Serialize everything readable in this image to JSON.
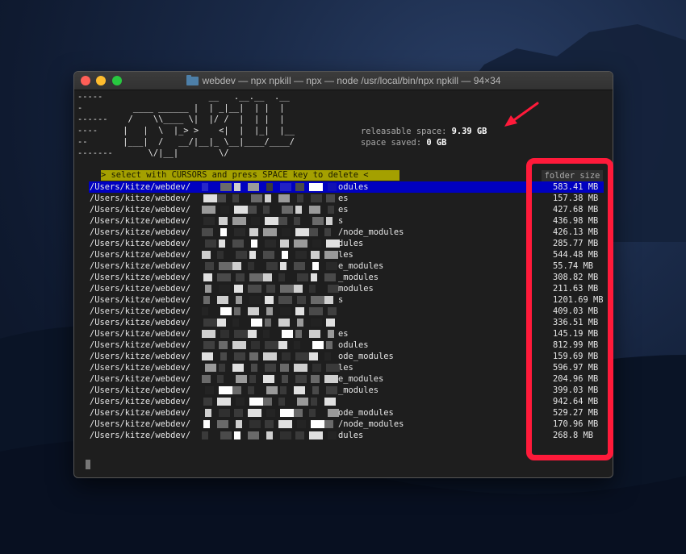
{
  "window": {
    "title": "webdev — npx npkill — npx — node /usr/local/bin/npx npkill — 94×34"
  },
  "banner": {
    "ascii_lines": [
      "-----                     __   .__.__  .__",
      "-          ____ ______ |  | _|__|  | |  |",
      "------    /    \\\\____ \\|  |/ /  |  | |  |",
      "----     |   |  \\  |_> >    <|  |  |_|  |__",
      "--       |___|  /   __/|__|_ \\__|____/____/",
      "-------       \\/|__|        \\/"
    ],
    "releasable_label": "releasable space:",
    "releasable_value": "9.39 GB",
    "saved_label": "space saved:",
    "saved_value": "0 GB"
  },
  "instructions": "> select with CURSORS and press SPACE key to delete <",
  "column_header": "folder size",
  "rows": [
    {
      "path": "/Users/kitze/webdev/",
      "tail": "odules",
      "size": "583.41 MB",
      "selected": true
    },
    {
      "path": "/Users/kitze/webdev/",
      "tail": "es",
      "size": "157.38 MB"
    },
    {
      "path": "/Users/kitze/webdev/",
      "tail": "es",
      "size": "427.68 MB"
    },
    {
      "path": "/Users/kitze/webdev/",
      "tail": "s",
      "size": "436.98 MB"
    },
    {
      "path": "/Users/kitze/webdev/",
      "tail": "/node_modules",
      "size": "426.13 MB"
    },
    {
      "path": "/Users/kitze/webdev/",
      "tail": "dules",
      "size": "285.77 MB"
    },
    {
      "path": "/Users/kitze/webdev/",
      "tail": "les",
      "size": "544.48 MB"
    },
    {
      "path": "/Users/kitze/webdev/",
      "tail": "e_modules",
      "size": "55.74 MB"
    },
    {
      "path": "/Users/kitze/webdev/",
      "tail": "_modules",
      "size": "308.82 MB"
    },
    {
      "path": "/Users/kitze/webdev/",
      "tail": "modules",
      "size": "211.63 MB"
    },
    {
      "path": "/Users/kitze/webdev/",
      "tail": "s",
      "size": "1201.69 MB"
    },
    {
      "path": "/Users/kitze/webdev/",
      "tail": "",
      "size": "409.03 MB"
    },
    {
      "path": "/Users/kitze/webdev/",
      "tail": "",
      "size": "336.51 MB"
    },
    {
      "path": "/Users/kitze/webdev/",
      "tail": "es",
      "size": "145.19 MB"
    },
    {
      "path": "/Users/kitze/webdev/",
      "tail": "odules",
      "size": "812.99 MB"
    },
    {
      "path": "/Users/kitze/webdev/",
      "tail": "ode_modules",
      "size": "159.69 MB"
    },
    {
      "path": "/Users/kitze/webdev/",
      "tail": "les",
      "size": "596.97 MB"
    },
    {
      "path": "/Users/kitze/webdev/",
      "tail": "e_modules",
      "size": "204.96 MB"
    },
    {
      "path": "/Users/kitze/webdev/",
      "tail": "_modules",
      "size": "399.03 MB"
    },
    {
      "path": "/Users/kitze/webdev/",
      "tail": "",
      "size": "942.64 MB"
    },
    {
      "path": "/Users/kitze/webdev/",
      "tail": "ode_modules",
      "size": "529.27 MB"
    },
    {
      "path": "/Users/kitze/webdev/",
      "tail": "/node_modules",
      "size": "170.96 MB"
    },
    {
      "path": "/Users/kitze/webdev/",
      "tail": "dules",
      "size": "268.8 MB"
    }
  ],
  "colors": {
    "selected_row": "#0000c0",
    "instructions_bg": "#a4a000",
    "highlight_box": "#ff1a3a",
    "arrow": "#ff1a3a"
  }
}
